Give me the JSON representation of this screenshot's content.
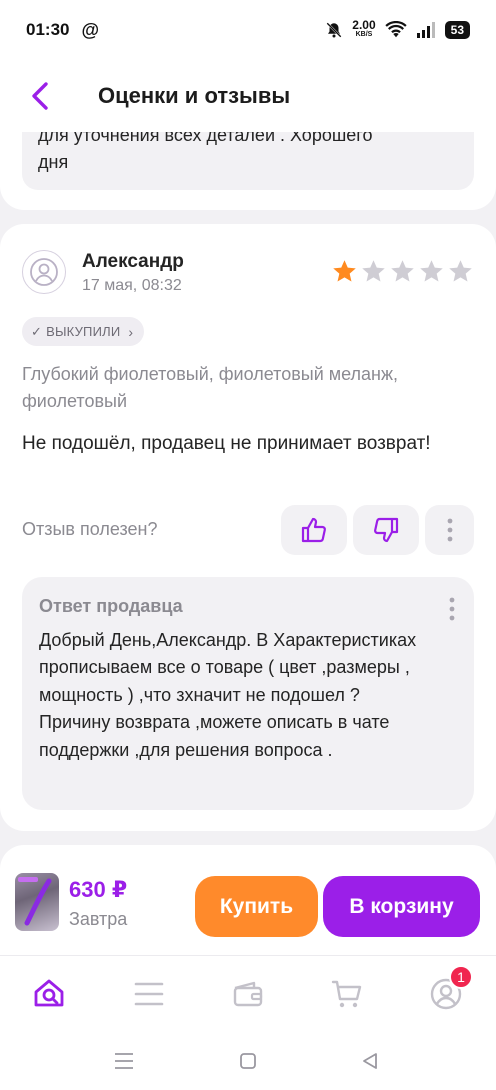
{
  "status_bar": {
    "time": "01:30",
    "at_symbol": "@",
    "net_speed": "2.00",
    "net_unit": "KB/S",
    "battery": "53"
  },
  "header": {
    "title": "Оценки и отзывы"
  },
  "prev_review": {
    "line1": "для уточнения всех деталей . Хорошего",
    "line2": "дня"
  },
  "review": {
    "author": "Александр",
    "date": "17 мая, 08:32",
    "rating": 1,
    "rating_max": 5,
    "star_filled_color": "#ff8a1f",
    "star_empty_color": "#cfcdd4",
    "bought_badge": "ВЫКУПИЛИ",
    "variant": "Глубокий фиолетовый, фиолетовый меланж, фиолетовый",
    "text": "Не подошёл, продавец не принимает возврат!",
    "helpful_label": "Отзыв полезен?",
    "seller_answer": {
      "title": "Ответ продавца",
      "text": "Добрый День,Александр. В Характеристиках прописываем все о товаре ( цвет ,размеры , мощность ) ,что зхначит не подошел ?\nПричину возврата ,можете описать в чате поддержки ,для решения вопроса ."
    }
  },
  "buy_bar": {
    "thumb_text": "",
    "price": "630 ₽",
    "delivery": "Завтра",
    "buy_label": "Купить",
    "cart_label": "В корзину",
    "buy_color": "#ff8a2b",
    "cart_color": "#9b1fe8"
  },
  "bottom_nav": {
    "items": [
      "home-search-icon",
      "catalog-icon",
      "wallet-icon",
      "cart-icon",
      "profile-icon"
    ],
    "profile_badge": "1",
    "active_color": "#9b1fe8"
  }
}
